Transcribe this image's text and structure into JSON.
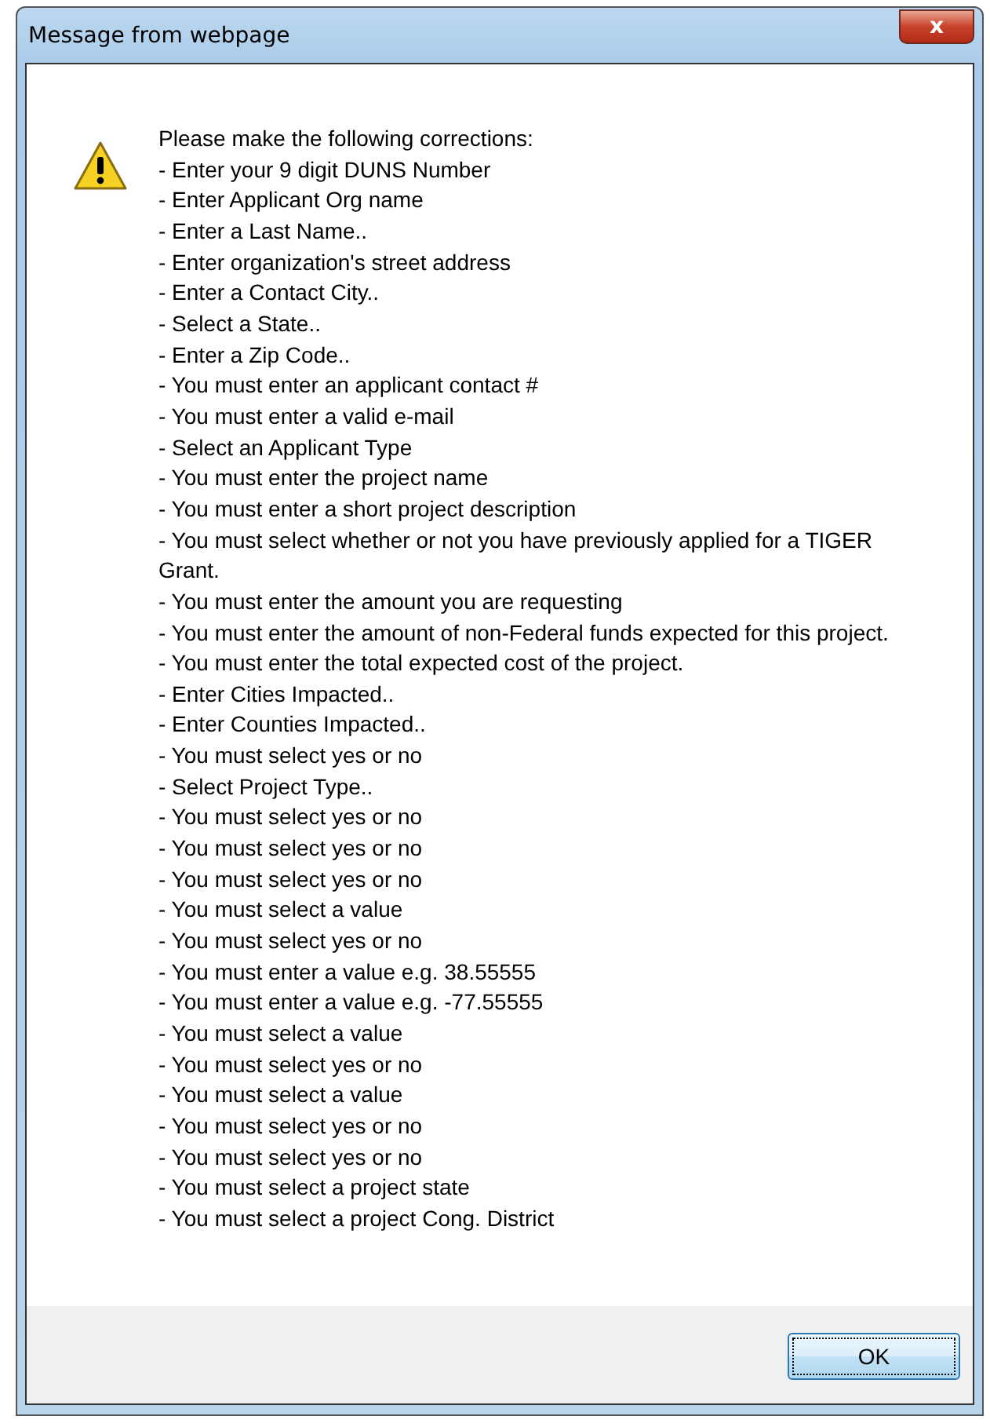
{
  "window": {
    "title": "Message from webpage",
    "close_button": "x"
  },
  "message": {
    "heading": "Please make the following corrections:",
    "lines": [
      "- Enter your 9 digit DUNS Number",
      "- Enter Applicant Org name",
      "- Enter a Last Name..",
      "- Enter organization's street address",
      "- Enter a Contact City..",
      "- Select a State..",
      "- Enter a Zip Code..",
      "- You must enter an applicant contact #",
      "- You must enter a valid e-mail",
      "- Select an Applicant Type",
      "- You must enter the project name",
      "- You must enter a short project description",
      "- You must select whether or not you have previously applied for a TIGER Grant.",
      "- You must enter the amount you are requesting",
      "- You must enter the amount of non-Federal funds expected for this project.",
      "- You must enter the total expected cost of the project.",
      "- Enter Cities Impacted..",
      "- Enter Counties Impacted..",
      "- You must select yes or no",
      "- Select Project Type..",
      "- You must select yes or no",
      "- You must select yes or no",
      "- You must select yes or no",
      "- You must select a value",
      "- You must select yes or no",
      "- You must enter a value e.g. 38.55555",
      "- You must enter a value e.g. -77.55555",
      "- You must select a value",
      "- You must select yes or no",
      "- You must select a value",
      "- You must select yes or no",
      "- You must select yes or no",
      "- You must select a project state",
      "- You must select a project Cong. District"
    ]
  },
  "buttons": [
    "OK"
  ]
}
